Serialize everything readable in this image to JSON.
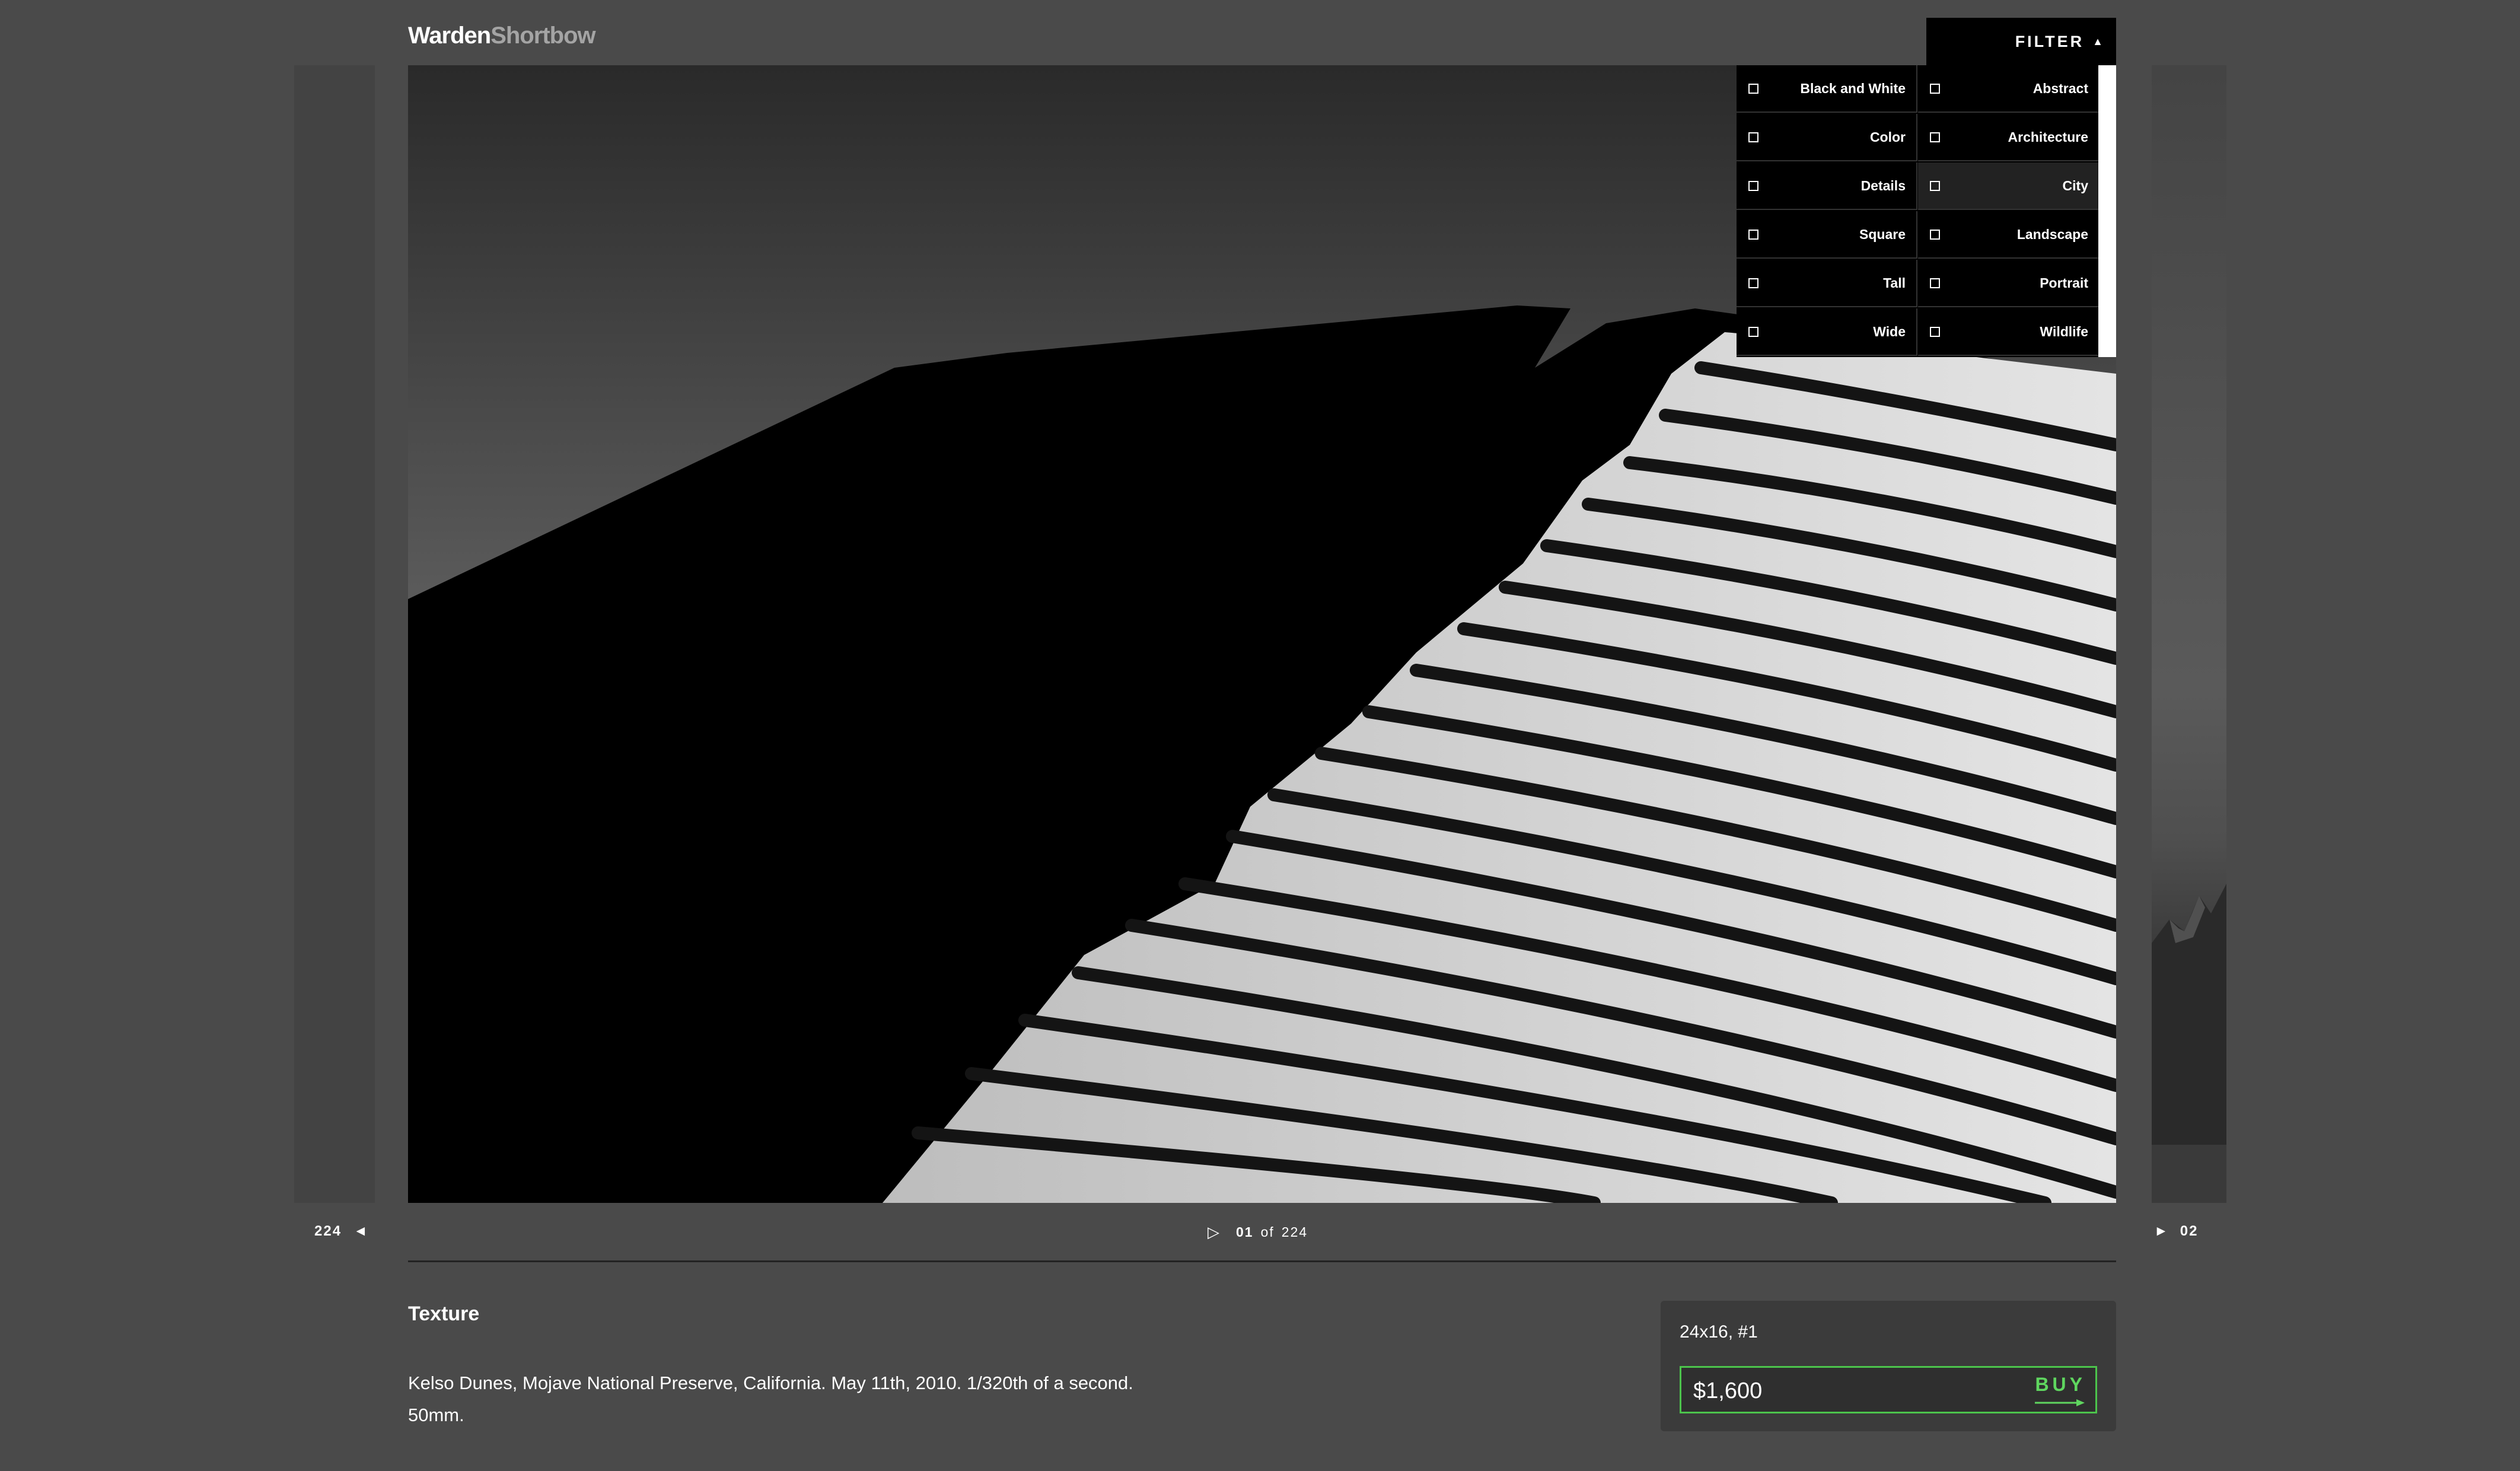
{
  "brand": {
    "part1": "Warden",
    "part2": "Shortbow"
  },
  "filter": {
    "label": "FILTER",
    "indicator": "▲",
    "column1": [
      "Black and White",
      "Color",
      "Details",
      "Square",
      "Tall",
      "Wide"
    ],
    "column2": [
      "Abstract",
      "Architecture",
      "City",
      "Landscape",
      "Portrait",
      "Wildlife"
    ],
    "highlighted": "City"
  },
  "nav": {
    "prev_number": "224",
    "prev_arrow": "◄",
    "next_number": "02",
    "next_arrow": "►",
    "play_icon": "▷",
    "current": "01",
    "of_label": "of",
    "total": "224"
  },
  "photo": {
    "title": "Texture",
    "description": "Kelso Dunes, Mojave National Preserve, California. May 11th, 2010. 1/320th of a second. 50mm."
  },
  "purchase": {
    "size": "24x16, #1",
    "price": "$1,600",
    "buy_label": "BUY",
    "accent_color": "#5fd65f"
  }
}
